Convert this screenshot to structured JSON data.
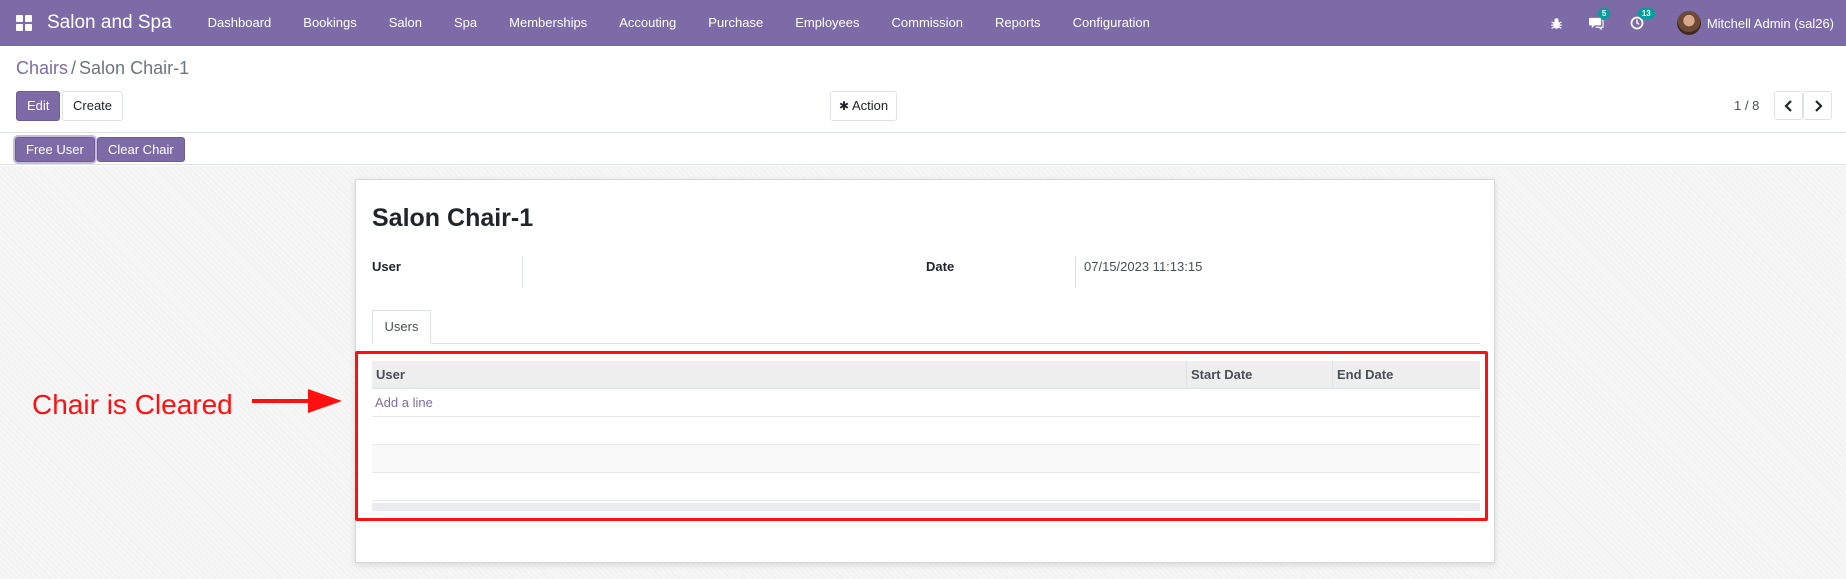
{
  "navbar": {
    "brand": "Salon and Spa",
    "menu": [
      "Dashboard",
      "Bookings",
      "Salon",
      "Spa",
      "Memberships",
      "Accouting",
      "Purchase",
      "Employees",
      "Commission",
      "Reports",
      "Configuration"
    ],
    "messages_count": "5",
    "activities_count": "13",
    "user": "Mitchell Admin (sal26)",
    "color": "#7c6ba6"
  },
  "breadcrumb": {
    "parent": "Chairs",
    "separator": "/",
    "current": "Salon Chair-1"
  },
  "buttons": {
    "edit": "Edit",
    "create": "Create",
    "action": "Action",
    "free_user": "Free User",
    "clear_chair": "Clear Chair"
  },
  "pager": {
    "value": "1 / 8"
  },
  "record": {
    "title": "Salon Chair-1",
    "user_label": "User",
    "user_value": "",
    "date_label": "Date",
    "date_value": "07/15/2023 11:13:15"
  },
  "tabs": [
    {
      "label": "Users"
    }
  ],
  "table": {
    "headers": [
      "User",
      "Start Date",
      "End Date"
    ],
    "add_line": "Add a line",
    "rows": []
  },
  "annotation": {
    "text": "Chair is Cleared",
    "color": "#ff1010"
  },
  "icons": {
    "apps": "apps-grid-icon",
    "bug": "bug-icon",
    "chat": "chat-icon",
    "activity": "clock-icon",
    "action": "gear-icon",
    "prev": "chevron-left-icon",
    "next": "chevron-right-icon"
  }
}
